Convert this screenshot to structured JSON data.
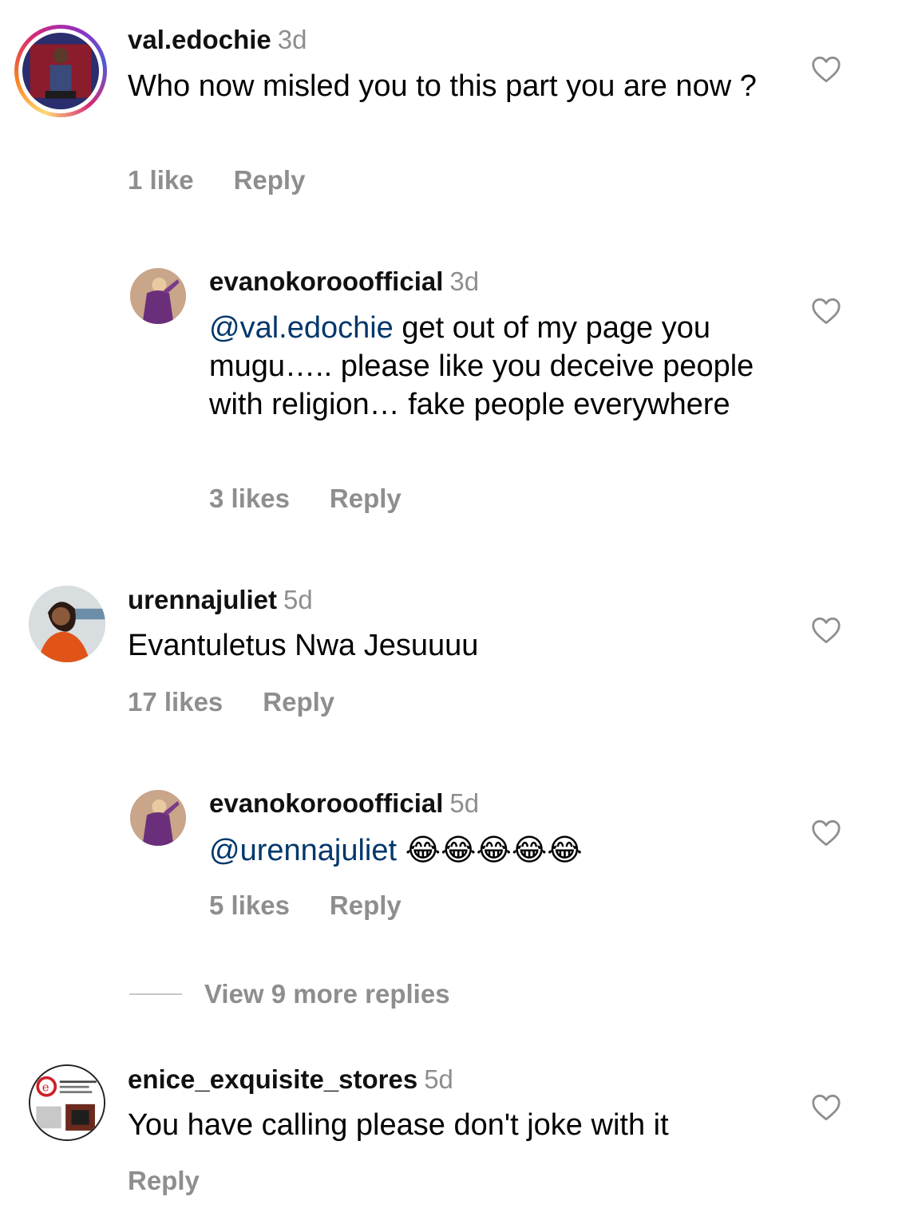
{
  "comments": [
    {
      "username": "val.edochie",
      "time": "3d",
      "text": "Who now misled you to this part you are now ?",
      "likes": "1 like",
      "reply": "Reply"
    },
    {
      "username": "evanokorooofficial",
      "time": "3d",
      "mention": "@val.edochie",
      "text": "get out of my page you mugu….. please like you deceive people with religion… fake people everywhere",
      "likes": "3 likes",
      "reply": "Reply"
    },
    {
      "username": "urennajuliet",
      "time": "5d",
      "text": "Evantuletus Nwa Jesuuuu",
      "likes": "17 likes",
      "reply": "Reply"
    },
    {
      "username": "evanokorooofficial",
      "time": "5d",
      "mention": "@urennajuliet",
      "text": "😂😂😂😂😂",
      "likes": "5 likes",
      "reply": "Reply"
    },
    {
      "username": "enice_exquisite_stores",
      "time": "5d",
      "text": "You have calling please don't joke with it",
      "reply": "Reply"
    }
  ],
  "view_more": "View 9 more replies",
  "icons": {
    "like": "heart-outline-icon"
  },
  "colors": {
    "secondary_text": "#8e8e8e",
    "mention": "#00376b"
  }
}
